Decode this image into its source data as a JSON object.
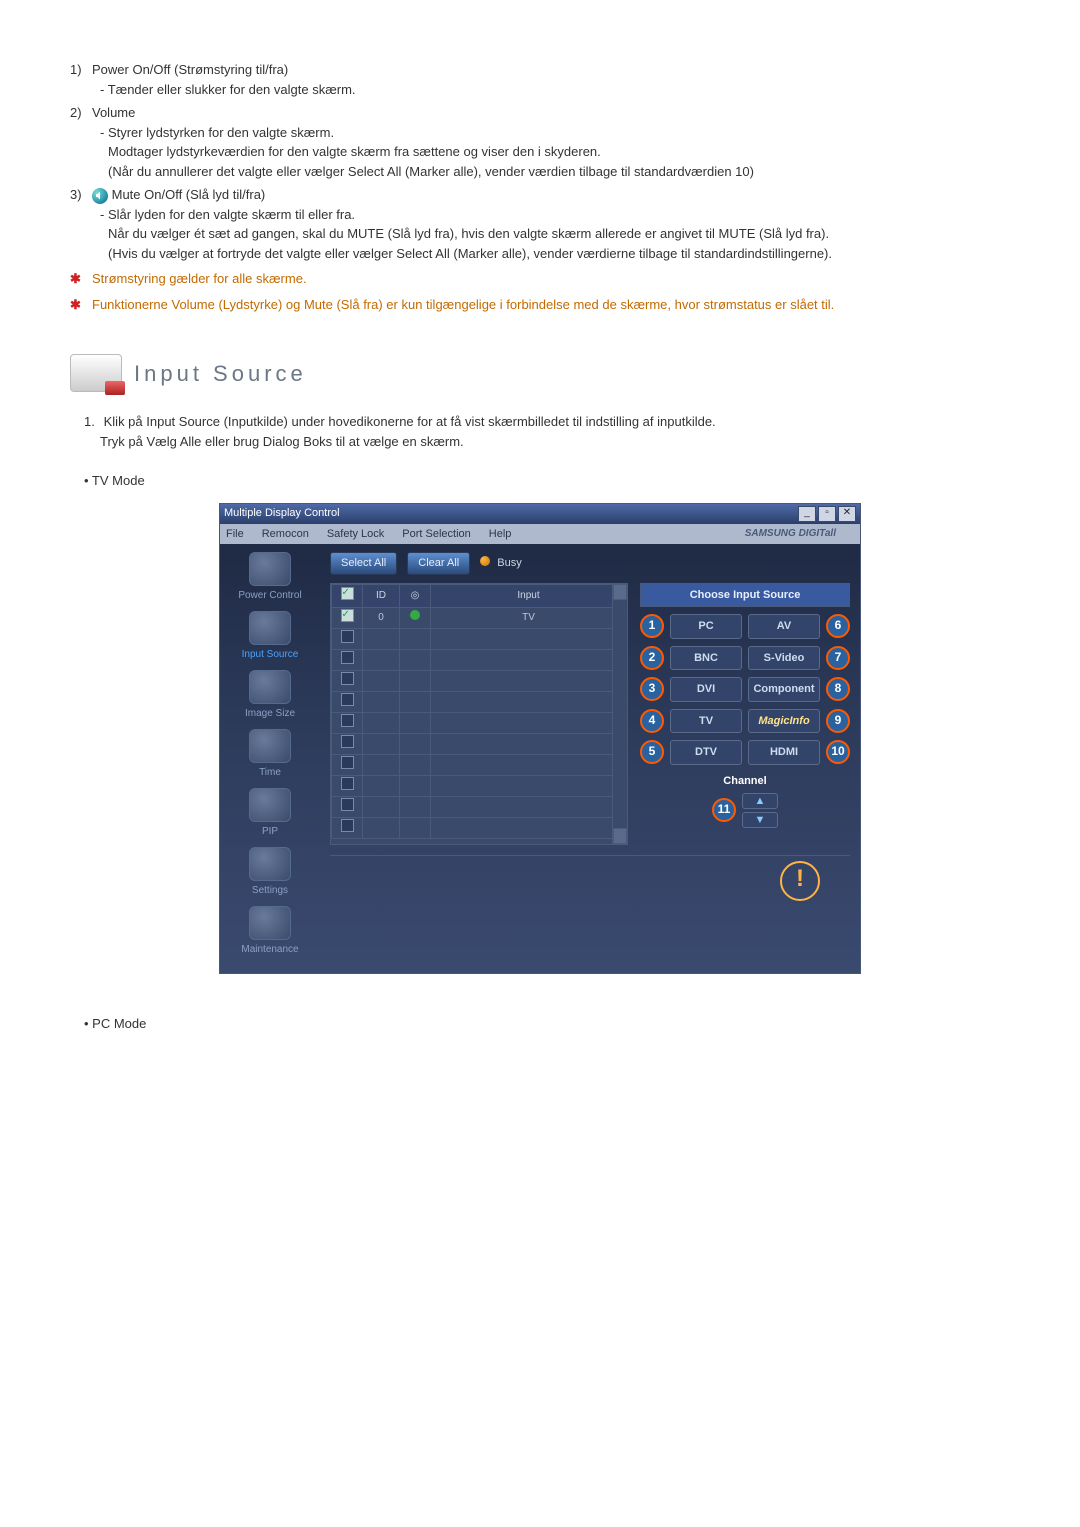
{
  "list": {
    "item1": {
      "num": "1)",
      "title": "Power On/Off (Strømstyring til/fra)",
      "line1": "- Tænder eller slukker for den valgte skærm."
    },
    "item2": {
      "num": "2)",
      "title": "Volume",
      "line1": "- Styrer lydstyrken for den valgte skærm.",
      "line2": "Modtager lydstyrkeværdien for den valgte skærm fra sættene og viser den i skyderen.",
      "line3": "(Når du annullerer det valgte eller vælger Select All (Marker alle), vender værdien tilbage til standardværdien 10)"
    },
    "item3": {
      "num": "3)",
      "title": "Mute On/Off (Slå lyd til/fra)",
      "line1": "- Slår lyden for den valgte skærm til eller fra.",
      "line2": "Når du vælger ét sæt ad gangen, skal du MUTE (Slå lyd fra), hvis den valgte skærm allerede er angivet til MUTE (Slå lyd fra).",
      "line3": "(Hvis du vælger at fortryde det valgte eller vælger Select All (Marker alle), vender værdierne tilbage til standardindstillingerne)."
    }
  },
  "star1": "Strømstyring gælder for alle skærme.",
  "star2": "Funktionerne Volume (Lydstyrke) og Mute (Slå fra) er kun tilgængelige i forbindelse med de skærme, hvor strømstatus er slået til.",
  "section_title": "Input Source",
  "instruction": {
    "n": "1.",
    "l1": "Klik på Input Source (Inputkilde) under hovedikonerne for at få vist skærmbilledet til indstilling af inputkilde.",
    "l2": "Tryk på Vælg Alle eller brug Dialog Boks til at vælge en skærm."
  },
  "tv_mode": "• TV Mode",
  "pc_mode": "• PC Mode",
  "app": {
    "title": "Multiple Display Control",
    "menu": {
      "m1": "File",
      "m2": "Remocon",
      "m3": "Safety Lock",
      "m4": "Port Selection",
      "m5": "Help"
    },
    "brand": "SAMSUNG DIGITall",
    "select_all": "Select All",
    "clear_all": "Clear All",
    "busy": "Busy",
    "thead": {
      "c1": "ID",
      "c2": "",
      "c3": "Input"
    },
    "row1": {
      "id": "0",
      "input": "TV"
    },
    "sidebar": {
      "s1": "Power Control",
      "s2": "Input Source",
      "s3": "Image Size",
      "s4": "Time",
      "s5": "PIP",
      "s6": "Settings",
      "s7": "Maintenance"
    },
    "panel": {
      "title": "Choose Input Source",
      "b1": "PC",
      "b2": "BNC",
      "b3": "DVI",
      "b4": "TV",
      "b5": "DTV",
      "b6": "AV",
      "b7": "S-Video",
      "b8": "Component",
      "b9": "MagicInfo",
      "b10": "HDMI",
      "channel": "Channel"
    },
    "callouts": {
      "c1": "1",
      "c2": "2",
      "c3": "3",
      "c4": "4",
      "c5": "5",
      "c6": "6",
      "c7": "7",
      "c8": "8",
      "c9": "9",
      "c10": "10",
      "c11": "11"
    }
  }
}
